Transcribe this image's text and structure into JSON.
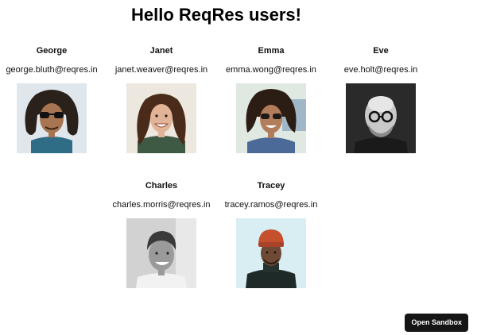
{
  "page": {
    "title": "Hello ReqRes users!"
  },
  "users": [
    {
      "name": "George",
      "email": "george.bluth@reqres.in"
    },
    {
      "name": "Janet",
      "email": "janet.weaver@reqres.in"
    },
    {
      "name": "Emma",
      "email": "emma.wong@reqres.in"
    },
    {
      "name": "Eve",
      "email": "eve.holt@reqres.in"
    },
    {
      "name": "Charles",
      "email": "charles.morris@reqres.in"
    },
    {
      "name": "Tracey",
      "email": "tracey.ramos@reqres.in"
    }
  ],
  "sandbox": {
    "label": "Open Sandbox"
  },
  "colors": {
    "button_bg": "#151515",
    "text": "#111111"
  }
}
